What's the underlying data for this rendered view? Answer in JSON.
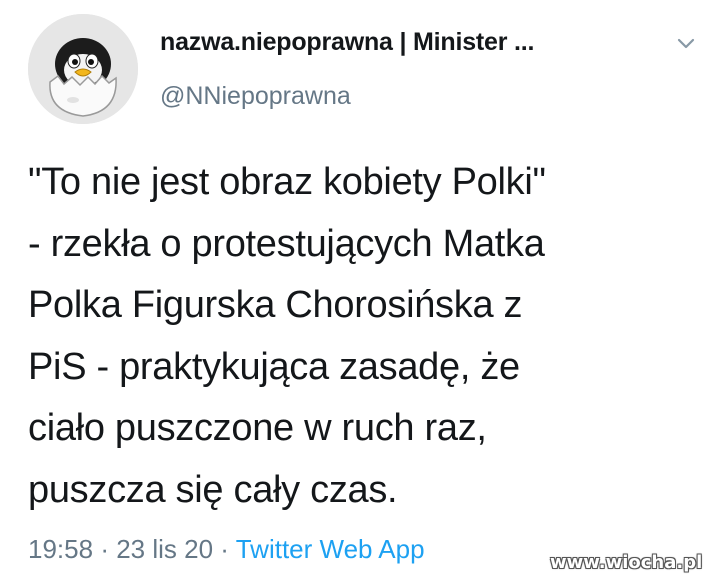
{
  "tweet": {
    "author": {
      "display_name": "nazwa.niepoprawna | Minister ...",
      "handle": "@NNiepoprawna",
      "avatar_icon": "penguin-in-eggshell-icon"
    },
    "text": "\"To nie jest obraz kobiety Polki\"\n- rzekła o protestujących Matka\nPolka Figurska Chorosińska z\nPiS - praktykująca zasadę, że\nciało puszczone w ruch raz,\npuszcza się cały czas.",
    "time": "19:58",
    "separator": "·",
    "date": "23 lis 20",
    "source": "Twitter Web App",
    "menu_icon": "chevron-down-icon"
  },
  "watermark": "www.wiocha.pl",
  "colors": {
    "text": "#14171a",
    "secondary": "#657786",
    "link": "#1da1f2",
    "background": "#ffffff"
  }
}
